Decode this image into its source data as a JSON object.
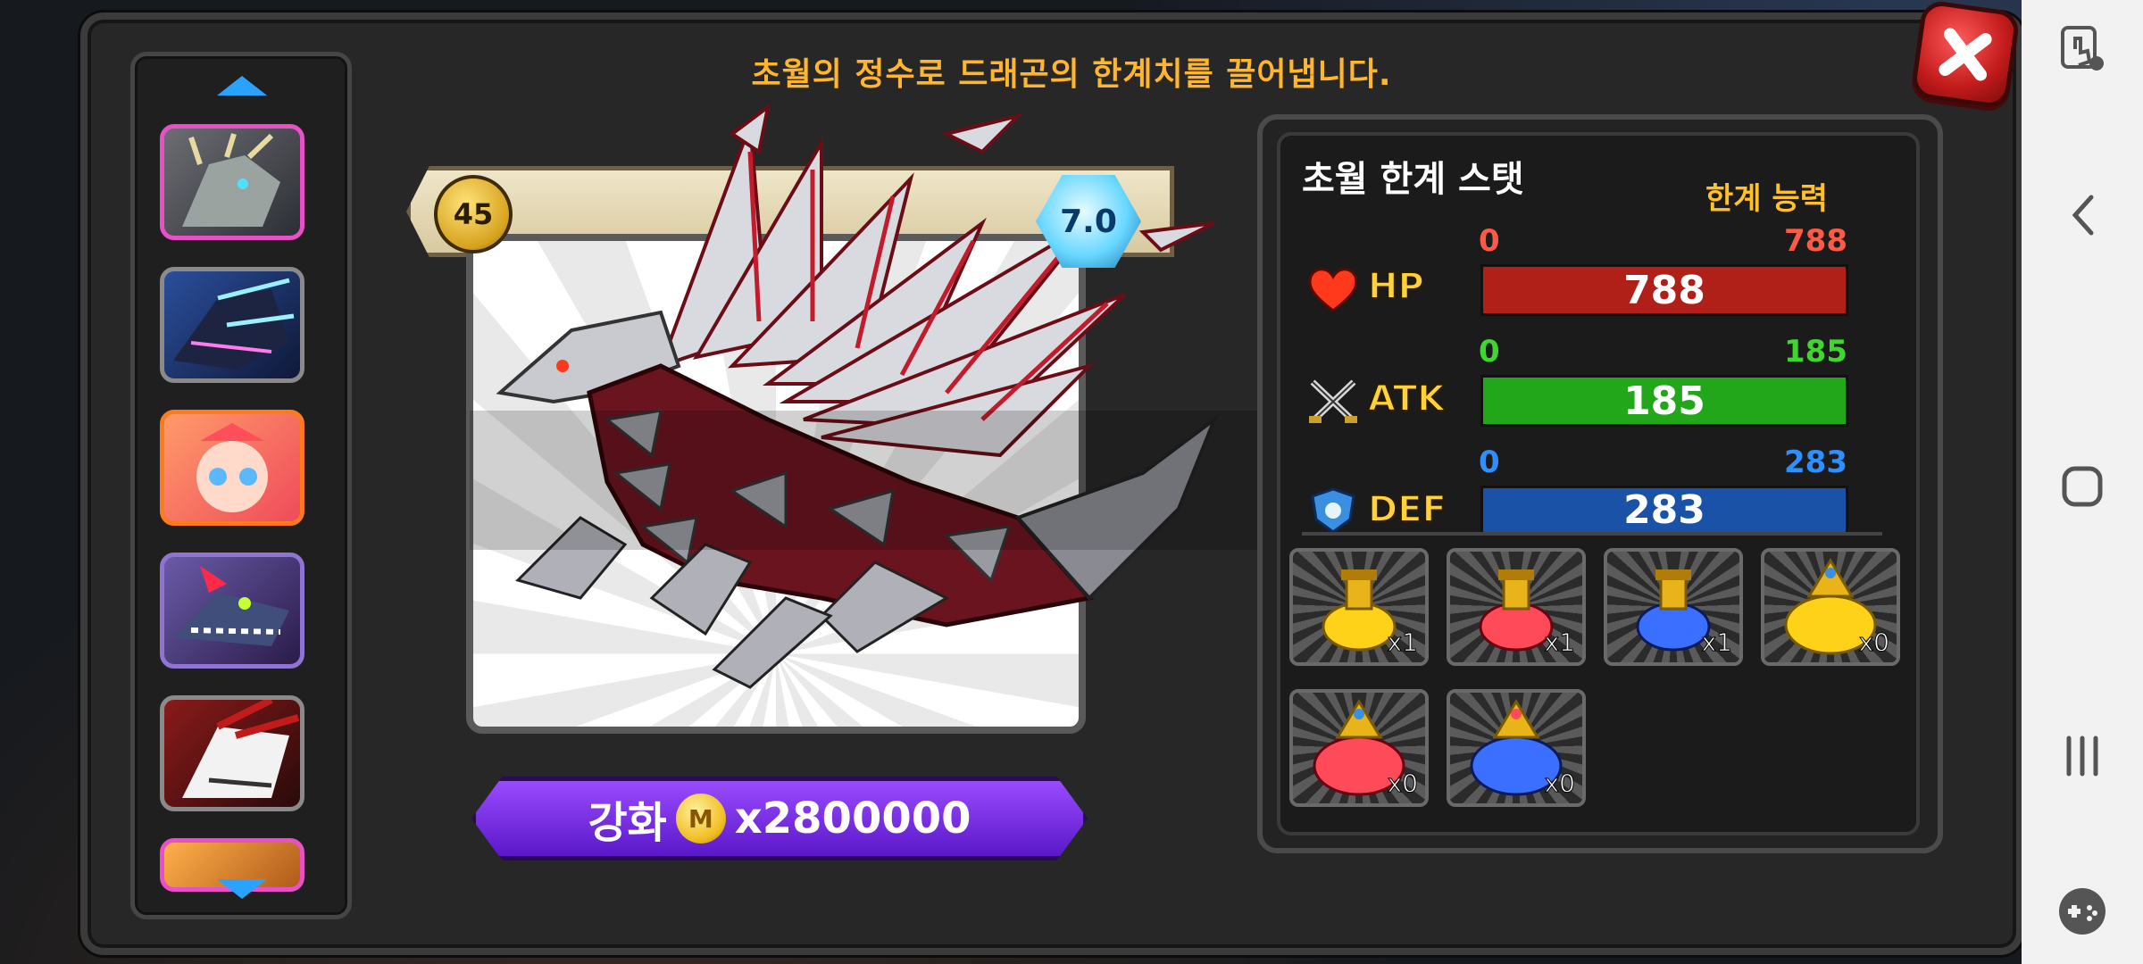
{
  "headline": "초월의 정수로 드래곤의 한계치를 끌어냅니다.",
  "dragon": {
    "level": "45",
    "grade": "7.0"
  },
  "upgrade": {
    "label": "강화",
    "coin_symbol": "M",
    "cost": "x2800000"
  },
  "stats": {
    "title": "초월 한계 스탯",
    "subtitle": "한계 능력",
    "rows": [
      {
        "label": "HP",
        "min": "0",
        "max": "788",
        "value": "788",
        "fraction": 1.0,
        "color": "#b02018",
        "num_color": "#ff5a46"
      },
      {
        "label": "ATK",
        "min": "0",
        "max": "185",
        "value": "185",
        "fraction": 1.0,
        "color": "#22a61a",
        "num_color": "#3fd62e"
      },
      {
        "label": "DEF",
        "min": "0",
        "max": "283",
        "value": "283",
        "fraction": 1.0,
        "color": "#1a52a8",
        "num_color": "#2f8fff"
      }
    ]
  },
  "items": [
    {
      "icon": "yellow-potion-icon",
      "qty": "x1"
    },
    {
      "icon": "red-potion-icon",
      "qty": "x1"
    },
    {
      "icon": "blue-potion-icon",
      "qty": "x1"
    },
    {
      "icon": "large-yellow-potion-icon",
      "qty": "x0"
    },
    {
      "icon": "large-red-potion-icon",
      "qty": "x0"
    },
    {
      "icon": "large-blue-potion-icon",
      "qty": "x0"
    }
  ]
}
